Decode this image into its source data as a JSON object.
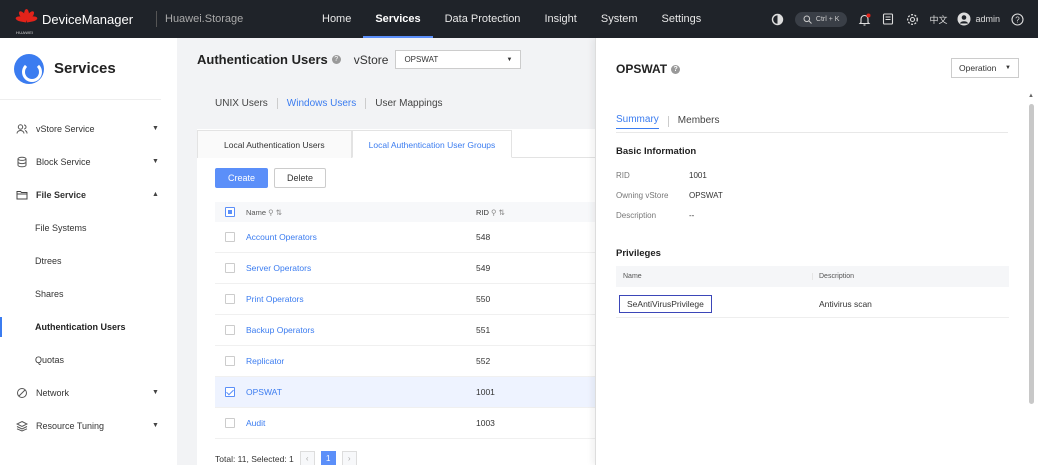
{
  "topbar": {
    "brand_word": "HUAWEI",
    "app_title": "DeviceManager",
    "sub_title": "Huawei.Storage",
    "nav": [
      "Home",
      "Services",
      "Data Protection",
      "Insight",
      "System",
      "Settings"
    ],
    "active_nav": "Services",
    "search_shortcut": "Ctrl + K",
    "language": "中文",
    "user": "admin"
  },
  "sidebar": {
    "title": "Services",
    "items": [
      {
        "label": "vStore Service",
        "icon": "users-icon",
        "expanded": false
      },
      {
        "label": "Block Service",
        "icon": "database-icon",
        "expanded": false
      },
      {
        "label": "File Service",
        "icon": "folder-icon",
        "expanded": true
      },
      {
        "label": "Network",
        "icon": "network-icon",
        "expanded": false
      },
      {
        "label": "Resource Tuning",
        "icon": "layers-icon",
        "expanded": false
      }
    ],
    "file_service_children": [
      "File Systems",
      "Dtrees",
      "Shares",
      "Authentication Users",
      "Quotas"
    ],
    "active_child": "Authentication Users"
  },
  "main": {
    "title": "Authentication Users",
    "vstore_label": "vStore",
    "vstore_value": "OPSWAT",
    "tabs": [
      "UNIX Users",
      "Windows Users",
      "User Mappings"
    ],
    "active_tab": "Windows Users",
    "subtabs": [
      "Local Authentication Users",
      "Local Authentication User Groups"
    ],
    "active_subtab": "Local Authentication User Groups",
    "create_label": "Create",
    "delete_label": "Delete",
    "columns": [
      "Name",
      "RID"
    ],
    "rows": [
      {
        "name": "Account Operators",
        "rid": "548",
        "checked": false
      },
      {
        "name": "Server Operators",
        "rid": "549",
        "checked": false
      },
      {
        "name": "Print Operators",
        "rid": "550",
        "checked": false
      },
      {
        "name": "Backup Operators",
        "rid": "551",
        "checked": false
      },
      {
        "name": "Replicator",
        "rid": "552",
        "checked": false
      },
      {
        "name": "OPSWAT",
        "rid": "1001",
        "checked": true
      },
      {
        "name": "Audit",
        "rid": "1003",
        "checked": false
      }
    ],
    "footer": "Total: 11, Selected: 1",
    "page_prev": "‹",
    "page_current": "1",
    "page_next": "›"
  },
  "panel": {
    "title": "OPSWAT",
    "operation_label": "Operation",
    "tabs": [
      "Summary",
      "Members"
    ],
    "active_tab": "Summary",
    "basic_info_title": "Basic Information",
    "info": [
      {
        "label": "RID",
        "value": "1001"
      },
      {
        "label": "Owning vStore",
        "value": "OPSWAT"
      },
      {
        "label": "Description",
        "value": "--"
      }
    ],
    "privileges_title": "Privileges",
    "privilege_columns": [
      "Name",
      "Description"
    ],
    "privileges": [
      {
        "name": "SeAntiVirusPrivilege",
        "description": "Antivirus scan"
      }
    ]
  },
  "colors": {
    "accent": "#3b7cf0",
    "topbar": "#1f2329",
    "primary_button": "#5b8ff9",
    "highlight_box": "#3b46b8"
  }
}
